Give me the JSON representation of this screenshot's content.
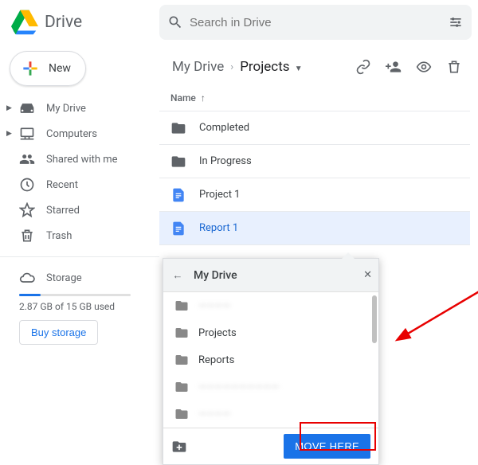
{
  "app": {
    "name": "Drive"
  },
  "search": {
    "placeholder": "Search in Drive"
  },
  "new_button": {
    "label": "New"
  },
  "sidebar": {
    "items": [
      {
        "label": "My Drive"
      },
      {
        "label": "Computers"
      },
      {
        "label": "Shared with me"
      },
      {
        "label": "Recent"
      },
      {
        "label": "Starred"
      },
      {
        "label": "Trash"
      }
    ],
    "storage_label": "Storage",
    "storage_used": "2.87 GB of 15 GB used",
    "buy_label": "Buy storage"
  },
  "breadcrumb": {
    "root": "My Drive",
    "current": "Projects"
  },
  "list": {
    "header": "Name",
    "rows": [
      {
        "name": "Completed",
        "type": "folder"
      },
      {
        "name": "In Progress",
        "type": "folder"
      },
      {
        "name": "Project 1",
        "type": "doc"
      },
      {
        "name": "Report 1",
        "type": "doc"
      }
    ]
  },
  "move_popover": {
    "title": "My Drive",
    "items": [
      {
        "name": "————",
        "blur": true
      },
      {
        "name": "Projects",
        "blur": false
      },
      {
        "name": "Reports",
        "blur": false
      },
      {
        "name": "——————————",
        "blur": true
      },
      {
        "name": "————",
        "blur": true
      },
      {
        "name": "——",
        "blur": true
      }
    ],
    "move_label": "MOVE HERE"
  }
}
